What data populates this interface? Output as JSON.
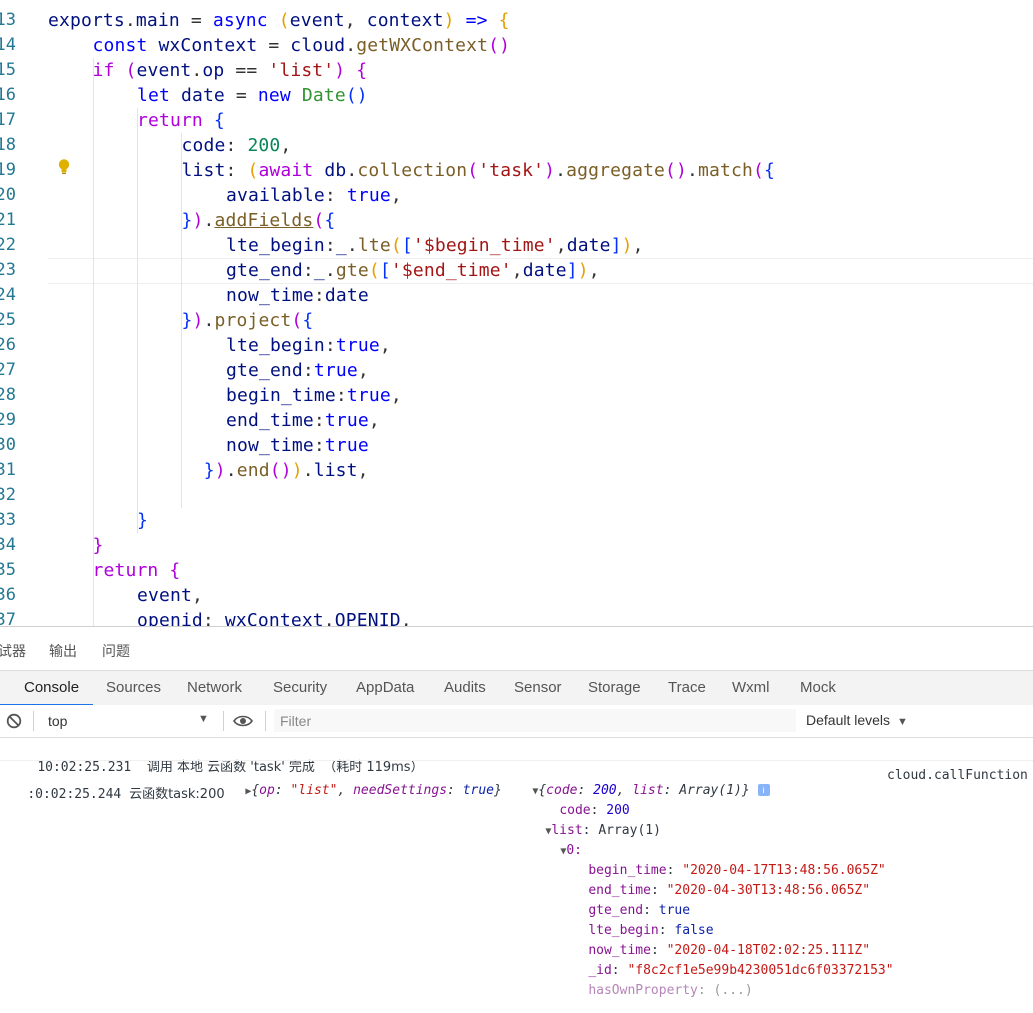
{
  "editor": {
    "lines": [
      {
        "num": "13",
        "indent": 0,
        "tokens": [
          [
            "v",
            "exports"
          ],
          [
            "p",
            "."
          ],
          [
            "v",
            "main"
          ],
          [
            "p",
            " = "
          ],
          [
            "b",
            "async"
          ],
          [
            "p",
            " "
          ],
          [
            "o",
            "("
          ],
          [
            "v",
            "event"
          ],
          [
            "p",
            ", "
          ],
          [
            "v",
            "context"
          ],
          [
            "o",
            ")"
          ],
          [
            "p",
            " "
          ],
          [
            "b",
            "=>"
          ],
          [
            "p",
            " "
          ],
          [
            "o",
            "{"
          ]
        ]
      },
      {
        "num": "14",
        "indent": 1,
        "tokens": [
          [
            "b",
            "const"
          ],
          [
            "p",
            " "
          ],
          [
            "v",
            "wxContext"
          ],
          [
            "p",
            " = "
          ],
          [
            "v",
            "cloud"
          ],
          [
            "p",
            "."
          ],
          [
            "f",
            "getWXContext"
          ],
          [
            "k",
            "()"
          ]
        ]
      },
      {
        "num": "15",
        "indent": 1,
        "tokens": [
          [
            "k",
            "if"
          ],
          [
            "p",
            " "
          ],
          [
            "k",
            "("
          ],
          [
            "v",
            "event"
          ],
          [
            "p",
            "."
          ],
          [
            "v",
            "op"
          ],
          [
            "p",
            " == "
          ],
          [
            "s",
            "'list'"
          ],
          [
            "k",
            ")"
          ],
          [
            "p",
            " "
          ],
          [
            "k",
            "{"
          ]
        ]
      },
      {
        "num": "16",
        "indent": 2,
        "tokens": [
          [
            "b",
            "let"
          ],
          [
            "p",
            " "
          ],
          [
            "v",
            "date"
          ],
          [
            "p",
            " = "
          ],
          [
            "b",
            "new"
          ],
          [
            "p",
            " "
          ],
          [
            "cy",
            "Date"
          ],
          [
            "bl",
            "()"
          ]
        ]
      },
      {
        "num": "17",
        "indent": 2,
        "tokens": [
          [
            "k",
            "return"
          ],
          [
            "p",
            " "
          ],
          [
            "bl",
            "{"
          ]
        ]
      },
      {
        "num": "18",
        "indent": 3,
        "tokens": [
          [
            "v",
            "code"
          ],
          [
            "p",
            ": "
          ],
          [
            "n",
            "200"
          ],
          [
            "p",
            ","
          ]
        ]
      },
      {
        "num": "19",
        "indent": 3,
        "tokens": [
          [
            "v",
            "list"
          ],
          [
            "p",
            ": "
          ],
          [
            "o",
            "("
          ],
          [
            "k",
            "await"
          ],
          [
            "p",
            " "
          ],
          [
            "v",
            "db"
          ],
          [
            "p",
            "."
          ],
          [
            "f",
            "collection"
          ],
          [
            "k",
            "("
          ],
          [
            "s",
            "'task'"
          ],
          [
            "k",
            ")"
          ],
          [
            "p",
            "."
          ],
          [
            "f",
            "aggregate"
          ],
          [
            "k",
            "()"
          ],
          [
            "p",
            "."
          ],
          [
            "f",
            "match"
          ],
          [
            "k",
            "("
          ],
          [
            "bl",
            "{"
          ]
        ]
      },
      {
        "num": "20",
        "indent": 4,
        "tokens": [
          [
            "v",
            "available"
          ],
          [
            "p",
            ": "
          ],
          [
            "b",
            "true"
          ],
          [
            "p",
            ","
          ]
        ]
      },
      {
        "num": "21",
        "indent": 3,
        "tokens": [
          [
            "bl",
            "}"
          ],
          [
            "k",
            ")"
          ],
          [
            "p",
            "."
          ],
          [
            "f ul",
            "addFields"
          ],
          [
            "k",
            "("
          ],
          [
            "bl",
            "{"
          ]
        ]
      },
      {
        "num": "22",
        "indent": 4,
        "tokens": [
          [
            "v",
            "lte_begin"
          ],
          [
            "p",
            ":"
          ],
          [
            "v",
            "_"
          ],
          [
            "p",
            "."
          ],
          [
            "f",
            "lte"
          ],
          [
            "o",
            "("
          ],
          [
            "bl",
            "["
          ],
          [
            "s",
            "'$begin_time'"
          ],
          [
            "p",
            ","
          ],
          [
            "v",
            "date"
          ],
          [
            "bl",
            "]"
          ],
          [
            "o",
            ")"
          ],
          [
            "p",
            ","
          ]
        ]
      },
      {
        "num": "23",
        "indent": 4,
        "tokens": [
          [
            "v",
            "gte_end"
          ],
          [
            "p",
            ":"
          ],
          [
            "v",
            "_"
          ],
          [
            "p",
            "."
          ],
          [
            "f",
            "gte"
          ],
          [
            "o",
            "("
          ],
          [
            "bl",
            "["
          ],
          [
            "s",
            "'$end_time'"
          ],
          [
            "p",
            ","
          ],
          [
            "v",
            "date"
          ],
          [
            "bl",
            "]"
          ],
          [
            "o",
            ")"
          ],
          [
            "p",
            ","
          ]
        ]
      },
      {
        "num": "24",
        "indent": 4,
        "tokens": [
          [
            "v",
            "now_time"
          ],
          [
            "p",
            ":"
          ],
          [
            "v",
            "date"
          ]
        ]
      },
      {
        "num": "25",
        "indent": 3,
        "tokens": [
          [
            "bl",
            "}"
          ],
          [
            "k",
            ")"
          ],
          [
            "p",
            "."
          ],
          [
            "f",
            "project"
          ],
          [
            "k",
            "("
          ],
          [
            "bl",
            "{"
          ]
        ]
      },
      {
        "num": "26",
        "indent": 4,
        "tokens": [
          [
            "v",
            "lte_begin"
          ],
          [
            "p",
            ":"
          ],
          [
            "b",
            "true"
          ],
          [
            "p",
            ","
          ]
        ]
      },
      {
        "num": "27",
        "indent": 4,
        "tokens": [
          [
            "v",
            "gte_end"
          ],
          [
            "p",
            ":"
          ],
          [
            "b",
            "true"
          ],
          [
            "p",
            ","
          ]
        ]
      },
      {
        "num": "28",
        "indent": 4,
        "tokens": [
          [
            "v",
            "begin_time"
          ],
          [
            "p",
            ":"
          ],
          [
            "b",
            "true"
          ],
          [
            "p",
            ","
          ]
        ]
      },
      {
        "num": "29",
        "indent": 4,
        "tokens": [
          [
            "v",
            "end_time"
          ],
          [
            "p",
            ":"
          ],
          [
            "b",
            "true"
          ],
          [
            "p",
            ","
          ]
        ]
      },
      {
        "num": "30",
        "indent": 4,
        "tokens": [
          [
            "v",
            "now_time"
          ],
          [
            "p",
            ":"
          ],
          [
            "b",
            "true"
          ]
        ]
      },
      {
        "num": "31",
        "indent": 3.5,
        "tokens": [
          [
            "bl",
            "}"
          ],
          [
            "k",
            ")"
          ],
          [
            "p",
            "."
          ],
          [
            "f",
            "end"
          ],
          [
            "k",
            "()"
          ],
          [
            "o",
            ")"
          ],
          [
            "p",
            "."
          ],
          [
            "v",
            "list"
          ],
          [
            "p",
            ","
          ]
        ]
      },
      {
        "num": "32",
        "indent": 0,
        "tokens": []
      },
      {
        "num": "33",
        "indent": 2,
        "tokens": [
          [
            "bl",
            "}"
          ]
        ]
      },
      {
        "num": "34",
        "indent": 1,
        "tokens": [
          [
            "k",
            "}"
          ]
        ]
      },
      {
        "num": "35",
        "indent": 1,
        "tokens": [
          [
            "k",
            "return"
          ],
          [
            "p",
            " "
          ],
          [
            "k",
            "{"
          ]
        ]
      },
      {
        "num": "36",
        "indent": 2,
        "tokens": [
          [
            "v",
            "event"
          ],
          [
            "p",
            ","
          ]
        ]
      },
      {
        "num": "37",
        "indent": 2,
        "tokens": [
          [
            "v",
            "openid"
          ],
          [
            "p",
            ": "
          ],
          [
            "v",
            "wxContext"
          ],
          [
            "p",
            "."
          ],
          [
            "v",
            "OPENID"
          ],
          [
            "p",
            ","
          ]
        ]
      }
    ]
  },
  "panel_tabs": [
    "试器",
    "输出",
    "问题"
  ],
  "devtools_tabs": [
    "Console",
    "Sources",
    "Network",
    "Security",
    "AppData",
    "Audits",
    "Sensor",
    "Storage",
    "Trace",
    "Wxml",
    "Mock"
  ],
  "toolbar": {
    "context": "top",
    "filter_placeholder": "Filter",
    "levels": "Default levels"
  },
  "console": {
    "msg1_time": "10:02:25.231",
    "msg1_text": "调用 本地 云函数 'task' 完成  （耗时 119ms）",
    "msg2_time": ":0:02:25.244",
    "msg2_label": "云函数task:200",
    "msg2_source": "cloud.callFunction",
    "arg1": {
      "op_key": "op",
      "op_val": "\"list\"",
      "ns_key": "needSettings",
      "ns_val": "true"
    },
    "arg2": {
      "code_key": "code",
      "code_val": "200",
      "list_key": "list",
      "list_val": "Array(1)"
    },
    "tree": {
      "code_key": "code",
      "code_val": "200",
      "list_key": "list",
      "list_val": "Array(1)",
      "index": "0:",
      "begin_time_key": "begin_time",
      "begin_time_val": "\"2020-04-17T13:48:56.065Z\"",
      "end_time_key": "end_time",
      "end_time_val": "\"2020-04-30T13:48:56.065Z\"",
      "gte_end_key": "gte_end",
      "gte_end_val": "true",
      "lte_begin_key": "lte_begin",
      "lte_begin_val": "false",
      "now_time_key": "now_time",
      "now_time_val": "\"2020-04-18T02:02:25.111Z\"",
      "id_key": "_id",
      "id_val": "\"f8c2cf1e5e99b4230051dc6f03372153\"",
      "hop_key": "hasOwnProperty",
      "hop_val": "(...)"
    }
  }
}
